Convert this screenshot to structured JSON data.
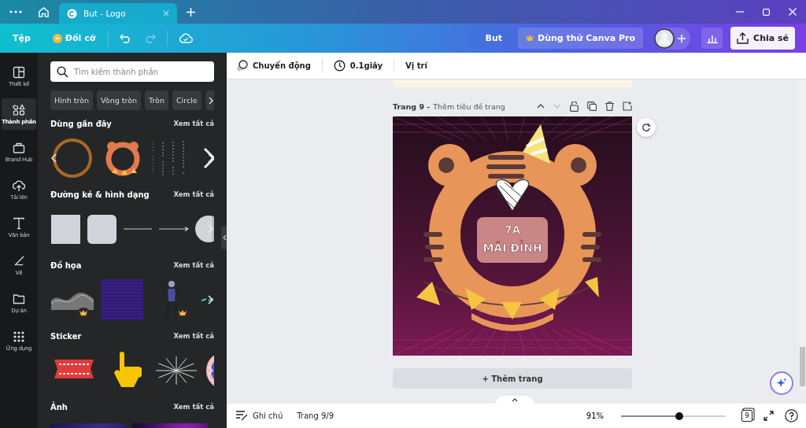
{
  "window": {
    "tabs": [
      {
        "label": "But - Logo",
        "selected": true
      }
    ]
  },
  "toolbar": {
    "file_menu": "Tệp",
    "resize": "Đối cỡ",
    "design_name": "But",
    "trial": "Dùng thử Canva Pro",
    "share": "Chia sẻ"
  },
  "rail": [
    {
      "label": "Thiết kế",
      "selected": false
    },
    {
      "label": "Thành phần",
      "selected": true
    },
    {
      "label": "Brand Hub",
      "selected": false
    },
    {
      "label": "Tải lên",
      "selected": false
    },
    {
      "label": "Văn bản",
      "selected": false
    },
    {
      "label": "Vẽ",
      "selected": false
    },
    {
      "label": "Dự án",
      "selected": false
    },
    {
      "label": "Ứng dụng",
      "selected": false
    }
  ],
  "panel": {
    "search": {
      "placeholder": "Tìm kiếm thành phần"
    },
    "chips": [
      "Hình tròn",
      "Vòng tròn",
      "Tròn",
      "Circle"
    ],
    "sections": [
      {
        "title": "Dùng gần đây",
        "see_all": "Xem tất cả",
        "thumbnails": [
          {
            "premium": false
          },
          {
            "premium": false
          },
          {
            "premium": false
          },
          {
            "premium": false
          }
        ]
      },
      {
        "title": "Đường kẻ & hình dạng",
        "see_all": "Xem tất cả",
        "thumbnails": [
          {
            "premium": false
          },
          {
            "premium": false
          },
          {
            "premium": false
          },
          {
            "premium": false
          },
          {
            "premium": false
          }
        ]
      },
      {
        "title": "Đồ họa",
        "see_all": "Xem tất cả",
        "thumbnails": [
          {
            "premium": true
          },
          {
            "premium": false
          },
          {
            "premium": true
          },
          {
            "premium": false
          }
        ]
      },
      {
        "title": "Sticker",
        "see_all": "Xem tất cả",
        "thumbnails": [
          {
            "premium": false
          },
          {
            "premium": false
          },
          {
            "premium": false
          },
          {
            "premium": false
          }
        ]
      },
      {
        "title": "Ảnh",
        "see_all": "Xem tất cả",
        "kind": "photos"
      }
    ]
  },
  "context_bar": {
    "animate": "Chuyển động",
    "duration": "0.1giây",
    "position": "Vị trí"
  },
  "page": {
    "label": "Trang 9 -",
    "title_placeholder": "Thêm tiêu đề trang",
    "design_texts": [
      "7A",
      "MÃI ĐỈNH"
    ],
    "add_page": "+ Thêm trang"
  },
  "status_bar": {
    "notes": "Ghi chú",
    "page_count": "Trang 9/9",
    "zoom": "91%",
    "zoom_slider": {
      "level": 0.56
    },
    "page_badge": "9"
  }
}
